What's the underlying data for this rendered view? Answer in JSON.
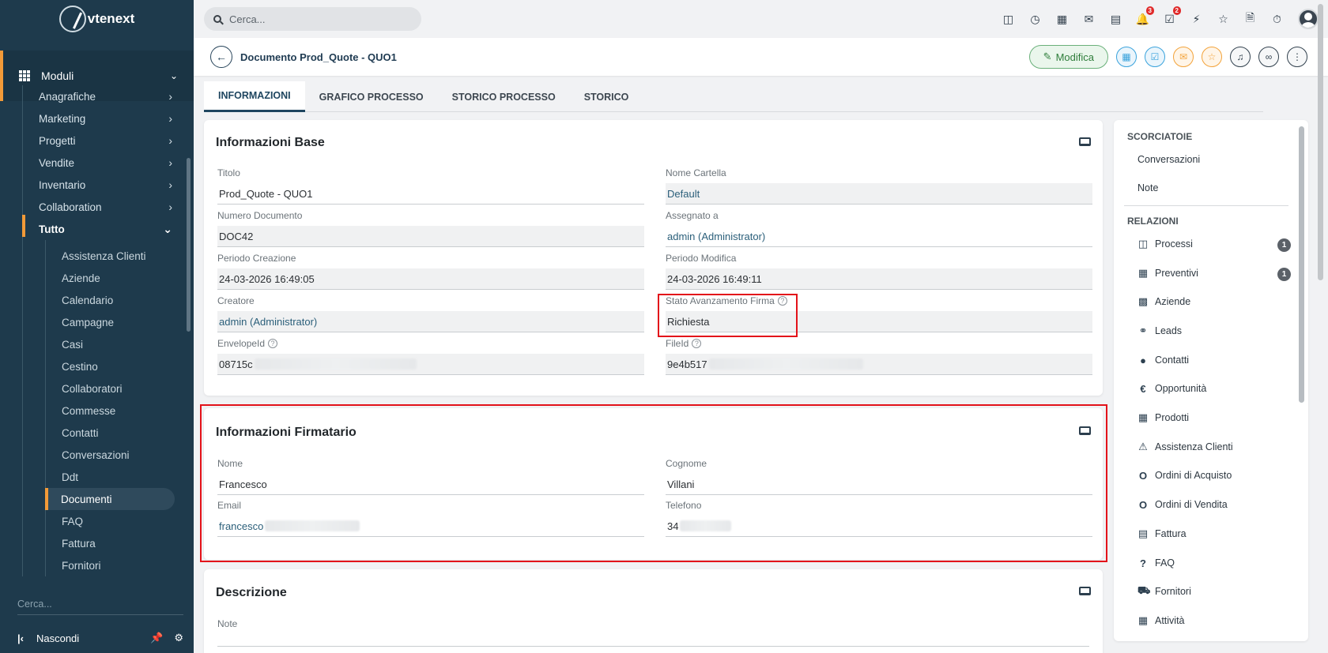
{
  "app": {
    "logo_text": "vtenext"
  },
  "sidebar": {
    "modules_label": "Moduli",
    "items": [
      {
        "label": "Anagrafiche"
      },
      {
        "label": "Marketing"
      },
      {
        "label": "Progetti"
      },
      {
        "label": "Vendite"
      },
      {
        "label": "Inventario"
      },
      {
        "label": "Collaboration"
      },
      {
        "label": "Tutto"
      }
    ],
    "sub_items": [
      {
        "label": "Assistenza Clienti"
      },
      {
        "label": "Aziende"
      },
      {
        "label": "Calendario"
      },
      {
        "label": "Campagne"
      },
      {
        "label": "Casi"
      },
      {
        "label": "Cestino"
      },
      {
        "label": "Collaboratori"
      },
      {
        "label": "Commesse"
      },
      {
        "label": "Contatti"
      },
      {
        "label": "Conversazioni"
      },
      {
        "label": "Ddt"
      },
      {
        "label": "Documenti"
      },
      {
        "label": "FAQ"
      },
      {
        "label": "Fattura"
      },
      {
        "label": "Fornitori"
      }
    ],
    "search_placeholder": "Cerca...",
    "hide_label": "Nascondi"
  },
  "topbar": {
    "search_placeholder": "Cerca...",
    "notifications_count": "3",
    "tasks_count": "2"
  },
  "header": {
    "title": "Documento Prod_Quote - QUO1",
    "edit_label": "Modifica"
  },
  "tabs": [
    {
      "label": "INFORMAZIONI"
    },
    {
      "label": "GRAFICO PROCESSO"
    },
    {
      "label": "STORICO PROCESSO"
    },
    {
      "label": "STORICO"
    }
  ],
  "base_info": {
    "title": "Informazioni Base",
    "fields": {
      "titolo": {
        "label": "Titolo",
        "value": "Prod_Quote - QUO1"
      },
      "nome_cartella": {
        "label": "Nome Cartella",
        "value": "Default"
      },
      "numero_documento": {
        "label": "Numero Documento",
        "value": "DOC42"
      },
      "assegnato_a": {
        "label": "Assegnato a",
        "value": "admin (Administrator)"
      },
      "periodo_creazione": {
        "label": "Periodo Creazione",
        "value": "24-03-2026 16:49:05"
      },
      "periodo_modifica": {
        "label": "Periodo Modifica",
        "value": "24-03-2026 16:49:11"
      },
      "creatore": {
        "label": "Creatore",
        "value": "admin (Administrator)"
      },
      "stato_firma": {
        "label": "Stato Avanzamento Firma",
        "value": "Richiesta"
      },
      "envelope_id": {
        "label": "EnvelopeId",
        "value": "08715c"
      },
      "file_id": {
        "label": "FileId",
        "value": "9e4b517"
      }
    }
  },
  "signer_info": {
    "title": "Informazioni Firmatario",
    "fields": {
      "nome": {
        "label": "Nome",
        "value": "Francesco"
      },
      "cognome": {
        "label": "Cognome",
        "value": "Villani"
      },
      "email": {
        "label": "Email",
        "value": "francesco"
      },
      "telefono": {
        "label": "Telefono",
        "value": "34"
      }
    }
  },
  "description": {
    "title": "Descrizione",
    "note_label": "Note"
  },
  "right_panel": {
    "shortcuts_title": "SCORCIATOIE",
    "shortcuts": [
      {
        "label": "Conversazioni"
      },
      {
        "label": "Note"
      }
    ],
    "relations_title": "RELAZIONI",
    "relations": [
      {
        "label": "Processi",
        "icon": "process-icon",
        "count": "1"
      },
      {
        "label": "Preventivi",
        "icon": "calculator-icon",
        "count": "1"
      },
      {
        "label": "Aziende",
        "icon": "building-icon"
      },
      {
        "label": "Leads",
        "icon": "person-outline-icon"
      },
      {
        "label": "Contatti",
        "icon": "person-icon"
      },
      {
        "label": "Opportunità",
        "icon": "euro-icon"
      },
      {
        "label": "Prodotti",
        "icon": "products-icon"
      },
      {
        "label": "Assistenza Clienti",
        "icon": "warning-icon"
      },
      {
        "label": "Ordini di Acquisto",
        "icon": "order-icon"
      },
      {
        "label": "Ordini di Vendita",
        "icon": "order-icon"
      },
      {
        "label": "Fattura",
        "icon": "document-icon"
      },
      {
        "label": "FAQ",
        "icon": "question-icon"
      },
      {
        "label": "Fornitori",
        "icon": "truck-icon"
      },
      {
        "label": "Attività",
        "icon": "calendar-icon"
      }
    ]
  }
}
